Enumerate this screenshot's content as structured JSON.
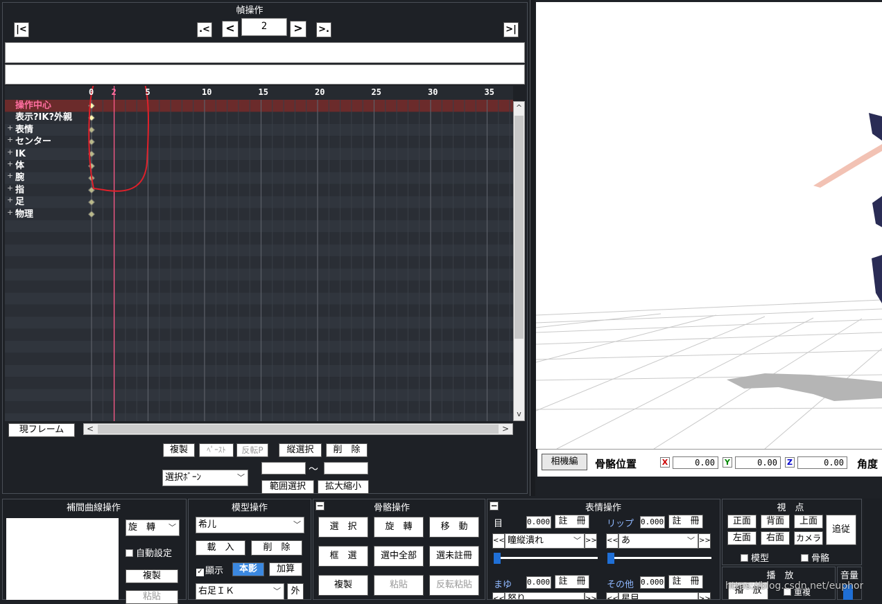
{
  "frame_panel": {
    "title": "幀操作",
    "first_btn": "|<",
    "prev_key_btn": ".<",
    "prev_btn": "<",
    "frame_value": "2",
    "next_btn": ">",
    "next_key_btn": ">.",
    "last_btn": ">|"
  },
  "timeline": {
    "ticks": [
      "0",
      "2",
      "5",
      "10",
      "15",
      "20",
      "25",
      "30",
      "35"
    ],
    "current_frame_label": "2",
    "tracks": [
      {
        "label": "操作中心",
        "expand": "",
        "selected": true
      },
      {
        "label": "表示?IK?外親",
        "expand": "",
        "selected": false
      },
      {
        "label": "表情",
        "expand": "+",
        "selected": false
      },
      {
        "label": "センター",
        "expand": "+",
        "selected": false
      },
      {
        "label": "IK",
        "expand": "+",
        "selected": false
      },
      {
        "label": "体",
        "expand": "+",
        "selected": false
      },
      {
        "label": "腕",
        "expand": "+",
        "selected": false
      },
      {
        "label": "指",
        "expand": "+",
        "selected": false
      },
      {
        "label": "足",
        "expand": "+",
        "selected": false
      },
      {
        "label": "物理",
        "expand": "+",
        "selected": false
      }
    ],
    "current_frame_btn": "現フレーム",
    "scroll_left": "<",
    "scroll_right": ">",
    "scroll_up": "^",
    "scroll_down": "v"
  },
  "edit_row": {
    "copy": "複製",
    "paste": "ﾍﾟｰｽﾄ",
    "reverse_paste": "反転P",
    "vertical_select": "縦選択",
    "delete": "削　除",
    "bone_select": "選択ﾎﾞｰﾝ",
    "tilde": "～",
    "range_select": "範囲選択",
    "scale": "拡大縮小"
  },
  "viewport": {
    "camera_edit_btn": "相機編",
    "bone_pos_label": "骨骼位置",
    "x_label": "X",
    "x_value": "0.00",
    "y_label": "Y",
    "y_value": "0.00",
    "z_label": "Z",
    "z_value": "0.00",
    "angle_label": "角度"
  },
  "interp_panel": {
    "title": "補間曲線操作",
    "mode_select": "旋　轉",
    "auto_setting": "自動設定",
    "copy": "複製",
    "paste": "粘貼"
  },
  "model_panel": {
    "title": "模型操作",
    "model_select": "希儿",
    "load": "載　入",
    "delete": "削　除",
    "display": "顯示",
    "shadow": "本影",
    "add": "加算",
    "bone_select": "右足ＩＫ",
    "outer": "外"
  },
  "bone_panel": {
    "title": "骨骼操作",
    "collapse": "−",
    "select": "選　択",
    "rotate": "旋　轉",
    "move": "移　動",
    "box_select": "框　選",
    "select_all": "選中全部",
    "unregistered": "選未註冊",
    "copy": "複製",
    "paste": "粘貼",
    "reverse_paste": "反転粘貼"
  },
  "morph_panel": {
    "title": "表情操作",
    "collapse": "−",
    "eye_label": "目",
    "eye_value": "0.000",
    "lip_label": "リップ",
    "lip_value": "0.000",
    "register": "註　冊",
    "eye_select": "瞳縦潰れ",
    "lip_select": "あ",
    "brow_label": "まゆ",
    "brow_value": "0.000",
    "other_label": "その他",
    "other_value": "0.000",
    "brow_select": "怒り",
    "other_select": "星目",
    "prev": "<<",
    "next": ">>"
  },
  "view_panel": {
    "title": "視　点",
    "front": "正面",
    "back": "背面",
    "top": "上面",
    "left": "左面",
    "right": "右面",
    "camera": "カメラ",
    "follow": "追従",
    "model_cb": "模型",
    "bone_cb": "骨骼"
  },
  "play_panel": {
    "title": "播　放",
    "play": "播　放",
    "repeat": "重複",
    "volume": "音量"
  },
  "watermark": "https://blog.csdn.net/euphorias",
  "colors": {
    "selected_row": "#6b2b2b",
    "current_frame_line": "#ff5a8a",
    "selected_text": "#ff6fa0",
    "annotation": "#e0202a"
  }
}
